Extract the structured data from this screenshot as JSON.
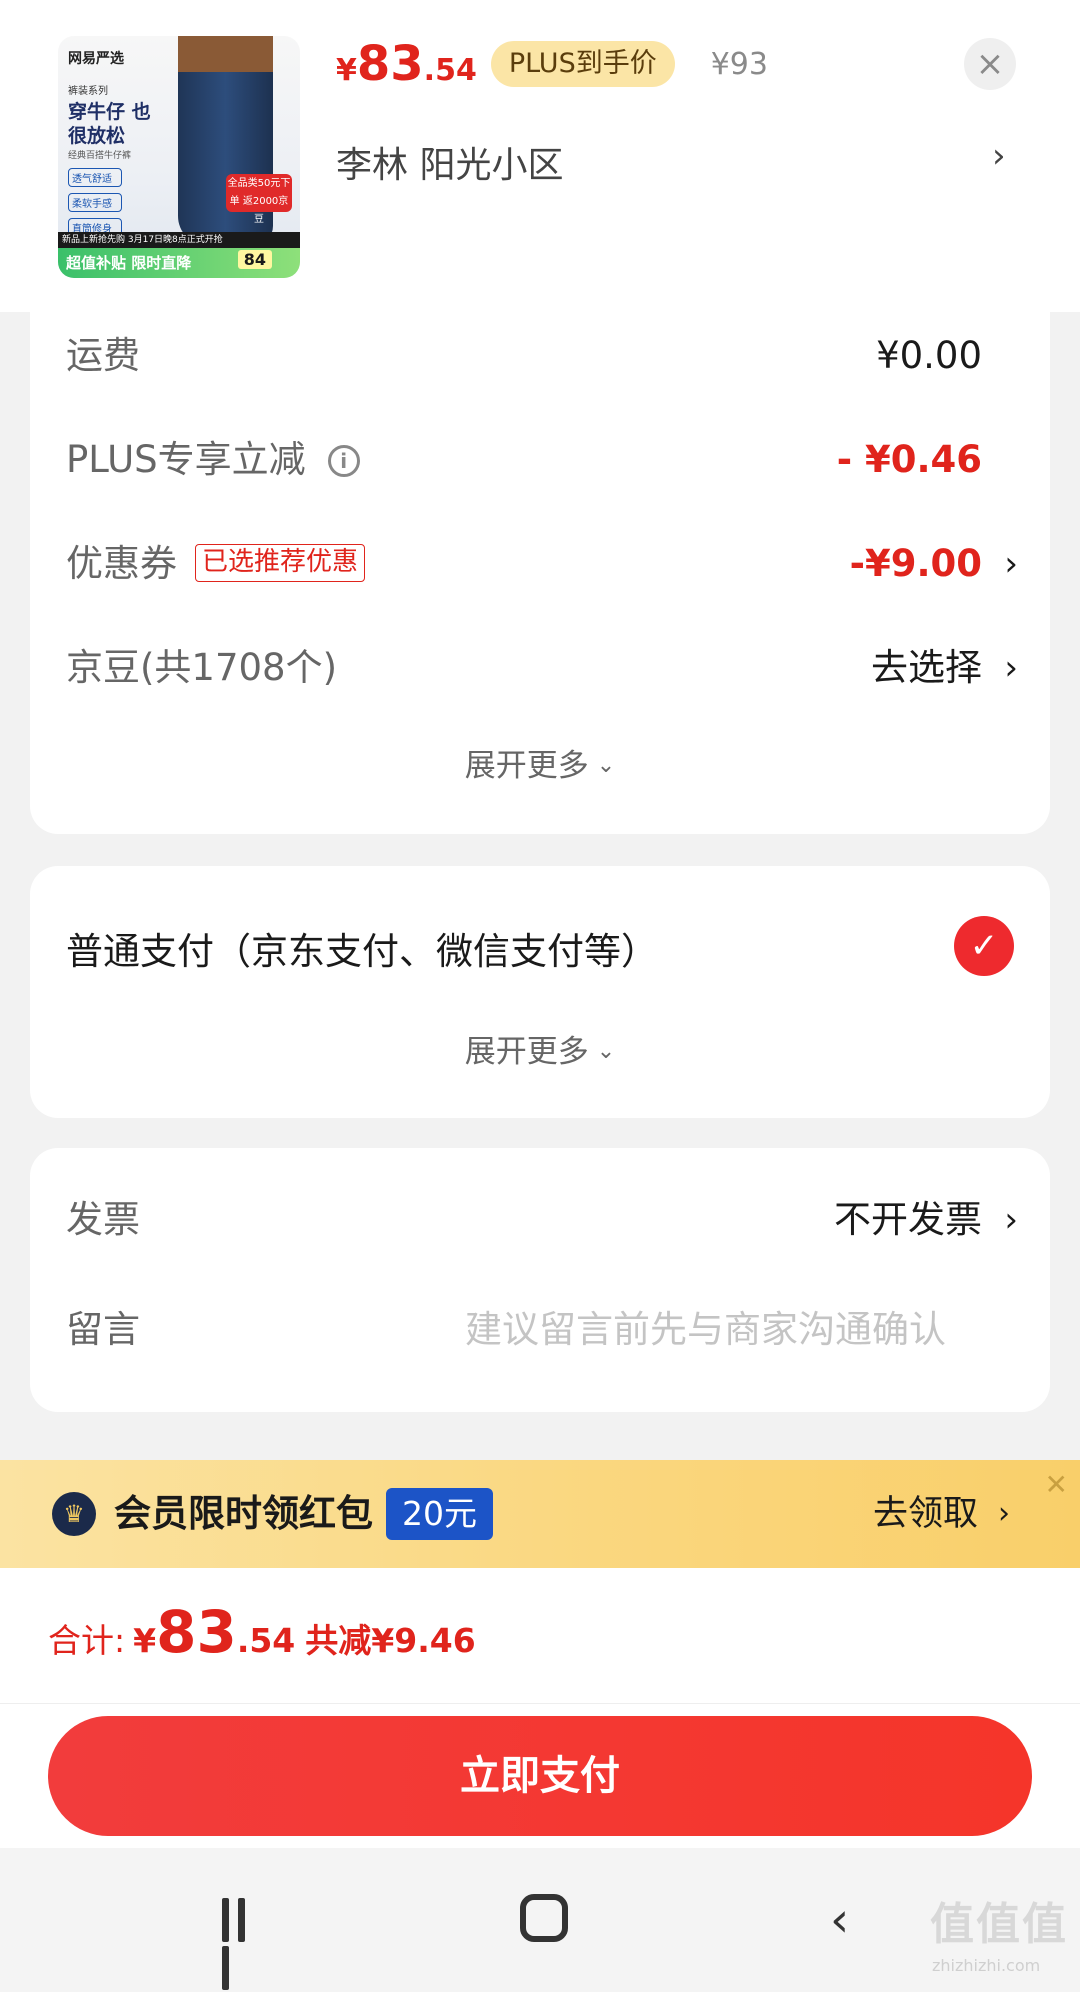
{
  "product": {
    "thumbnail": {
      "brand": "网易严选",
      "series": "裤装系列",
      "headline": "穿牛仔 也很放松",
      "subtitle": "经典百搭牛仔裤",
      "tags": [
        "透气舒适",
        "柔软手感",
        "直筒修身"
      ],
      "promo": "全品类50元下单 返2000京豆",
      "launch": "新品上新抢先购 3月17日晚8点正式开抢",
      "bottom_text": "超值补贴 限时直降",
      "bottom_price": "84"
    },
    "price_symbol": "¥",
    "price_int": "83",
    "price_dec": ".54",
    "plus_badge": "PLUS到手价",
    "original_price": "¥93",
    "close": "×",
    "address": "李林  阳光小区",
    "address_chevron": "›"
  },
  "fees": {
    "shipping_label": "运费",
    "shipping_value": "¥0.00",
    "plus_label": "PLUS专享立减",
    "plus_value": "- ¥0.46",
    "coupon_label": "优惠券",
    "coupon_tag": "已选推荐优惠",
    "coupon_value": "-¥9.00",
    "jingdou_label": "京豆(共1708个)",
    "jingdou_value": "去选择",
    "expand": "展开更多"
  },
  "payment": {
    "method": "普通支付（京东支付、微信支付等）",
    "expand": "展开更多"
  },
  "extras": {
    "invoice_label": "发票",
    "invoice_value": "不开发票",
    "note_label": "留言",
    "note_placeholder": "建议留言前先与商家沟通确认"
  },
  "banner": {
    "title": "会员限时领红包",
    "amount": "20元",
    "action": "去领取"
  },
  "summary": {
    "label": "合计:",
    "symbol": "¥",
    "int": "83",
    "dec": ".54",
    "saving": "共减¥9.46"
  },
  "pay_button": "立即支付",
  "watermark": {
    "logo": "值值值",
    "url": "zhizhizhi.com"
  },
  "colors": {
    "accent_red": "#e0241c",
    "plus_gold": "#fbe5a6",
    "banner_blue": "#1c54c7"
  }
}
